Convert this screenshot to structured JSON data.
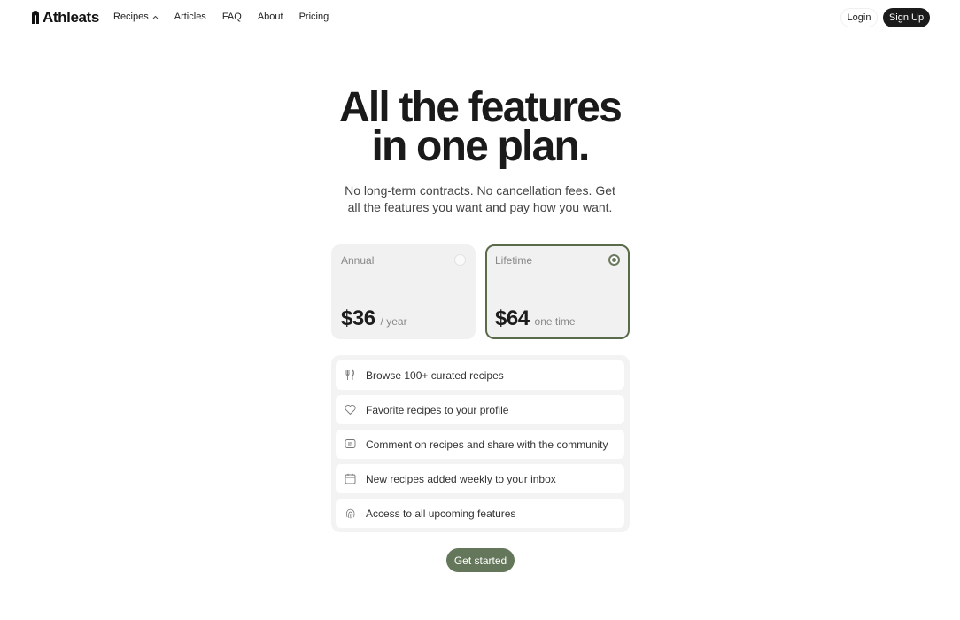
{
  "brand": {
    "name": "Athleats"
  },
  "nav": {
    "links": [
      "Recipes",
      "Articles",
      "FAQ",
      "About",
      "Pricing"
    ],
    "login": "Login",
    "signup": "Sign Up"
  },
  "hero": {
    "title_line1": "All the features",
    "title_line2": "in one plan.",
    "subtitle": "No long-term contracts. No cancellation fees. Get all the features you want and pay how you want."
  },
  "plans": [
    {
      "name": "Annual",
      "price": "$36",
      "unit": "/ year",
      "selected": false
    },
    {
      "name": "Lifetime",
      "price": "$64",
      "unit": "one time",
      "selected": true
    }
  ],
  "features": [
    {
      "icon": "utensils-icon",
      "text": "Browse 100+ curated recipes"
    },
    {
      "icon": "heart-icon",
      "text": "Favorite recipes to your profile"
    },
    {
      "icon": "comment-icon",
      "text": "Comment on recipes and share with the community"
    },
    {
      "icon": "calendar-icon",
      "text": "New recipes added weekly to your inbox"
    },
    {
      "icon": "fingerprint-icon",
      "text": "Access to all upcoming features"
    }
  ],
  "cta": {
    "label": "Get started"
  },
  "colors": {
    "accent": "#65775a",
    "selected_border": "#5a6b4c",
    "dark_button": "#1b1b1b"
  }
}
